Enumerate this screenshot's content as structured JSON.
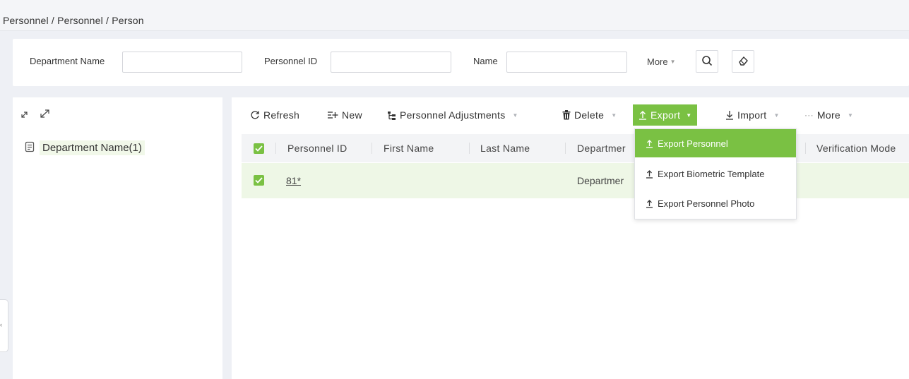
{
  "breadcrumb": "Personnel / Personnel / Person",
  "search": {
    "department_label": "Department Name",
    "department_value": "",
    "personnel_id_label": "Personnel ID",
    "personnel_id_value": "",
    "name_label": "Name",
    "name_value": "",
    "more_label": "More",
    "search_icon": "search-icon",
    "clear_icon": "eraser-icon"
  },
  "tree": {
    "expand_icon": "expand-icon",
    "collapse_icon": "collapse-icon",
    "item_label": "Department Name(1)"
  },
  "toolbar": {
    "refresh": "Refresh",
    "new": "New",
    "adjustments": "Personnel Adjustments",
    "delete": "Delete",
    "export": "Export",
    "import": "Import",
    "more": "More"
  },
  "grid": {
    "columns": [
      "Personnel ID",
      "First Name",
      "Last Name",
      "Departmer",
      "Verification Mode"
    ],
    "rows": [
      {
        "personnel_id": "81*",
        "first_name": "",
        "last_name": "",
        "department": "Departmer",
        "selected": true
      }
    ]
  },
  "export_menu": {
    "items": [
      "Export Personnel",
      "Export Biometric Template",
      "Export Personnel Photo"
    ],
    "active_index": 0
  },
  "colors": {
    "accent": "#7ac143",
    "selected_row": "#eef7e6",
    "background": "#eef0f5"
  }
}
